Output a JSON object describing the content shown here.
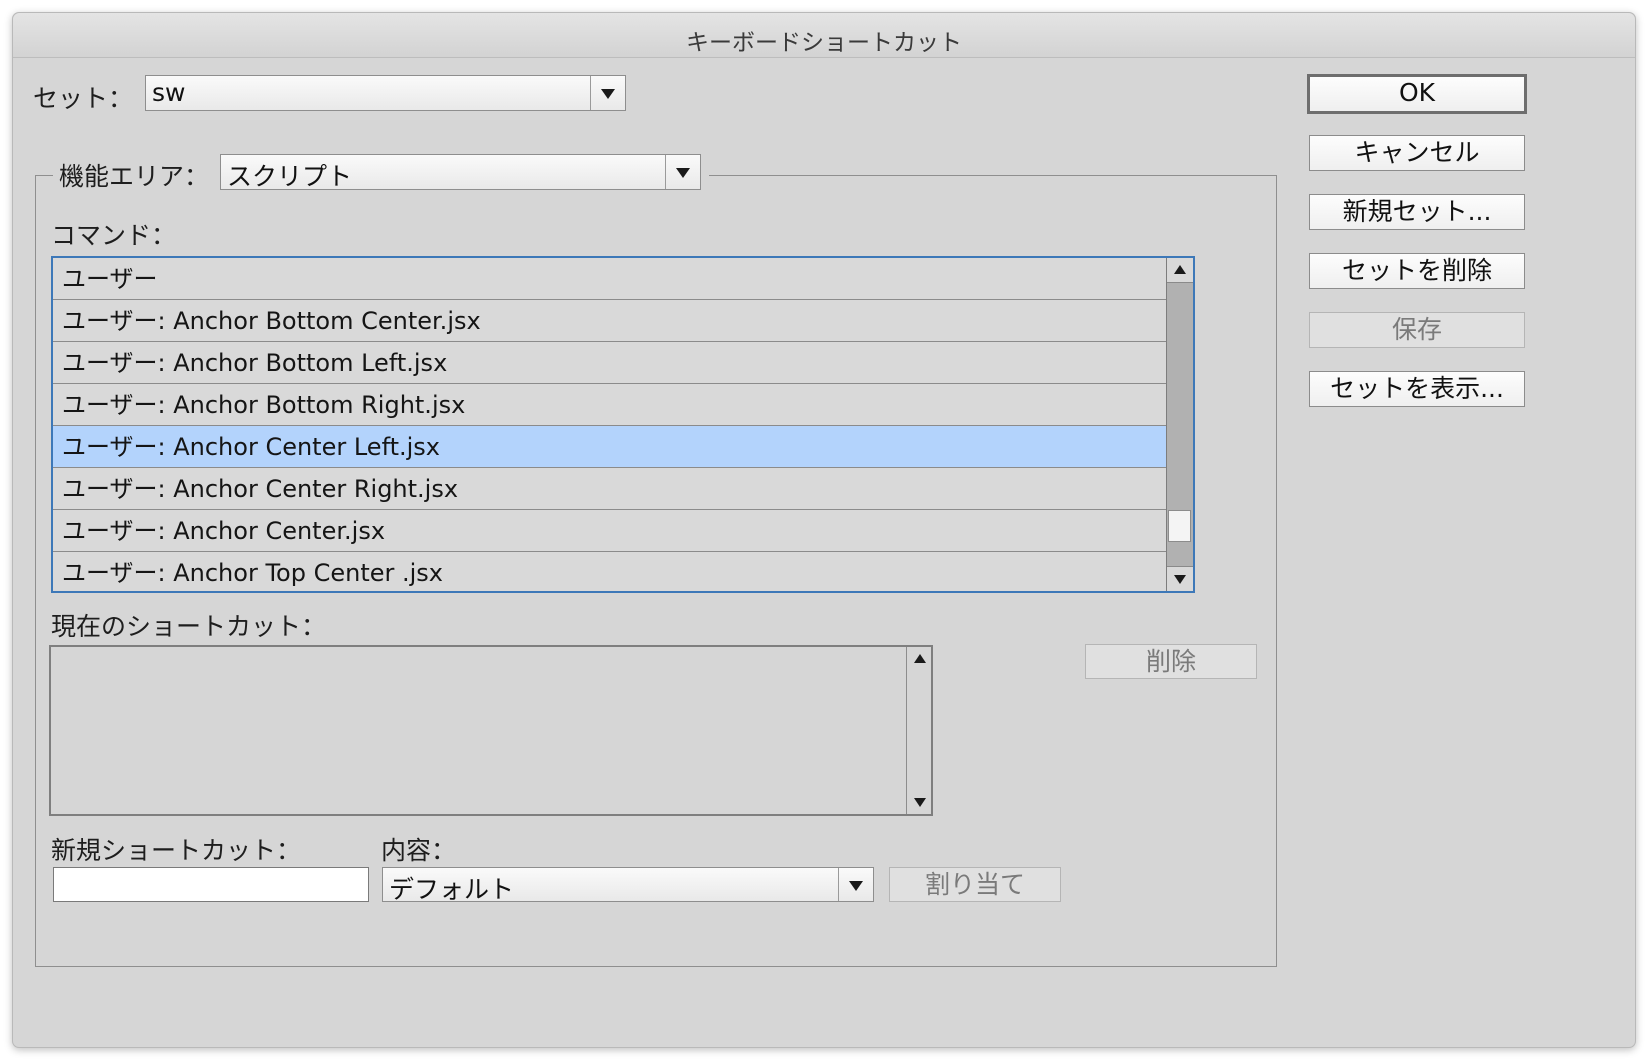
{
  "window": {
    "title": "キーボードショートカット"
  },
  "set": {
    "label": "セット：",
    "value": "sw"
  },
  "area": {
    "label": "機能エリア：",
    "value": "スクリプト"
  },
  "commands": {
    "label": "コマンド：",
    "items": [
      {
        "label": "ユーザー",
        "selected": false
      },
      {
        "label": "ユーザー: Anchor Bottom Center.jsx",
        "selected": false
      },
      {
        "label": "ユーザー: Anchor Bottom Left.jsx",
        "selected": false
      },
      {
        "label": "ユーザー: Anchor Bottom Right.jsx",
        "selected": false
      },
      {
        "label": "ユーザー: Anchor Center Left.jsx",
        "selected": true
      },
      {
        "label": "ユーザー: Anchor Center Right.jsx",
        "selected": false
      },
      {
        "label": "ユーザー: Anchor Center.jsx",
        "selected": false
      },
      {
        "label": "ユーザー: Anchor Top Center .jsx",
        "selected": false
      }
    ]
  },
  "current_shortcuts": {
    "label": "現在のショートカット：",
    "delete_label": "削除"
  },
  "new_shortcut": {
    "label": "新規ショートカット：",
    "value": ""
  },
  "context": {
    "label": "内容：",
    "value": "デフォルト"
  },
  "assign": {
    "label": "割り当て"
  },
  "buttons": {
    "ok": "OK",
    "cancel": "キャンセル",
    "new_set": "新規セット...",
    "delete_set": "セットを削除",
    "save": "保存",
    "show_set": "セットを表示..."
  },
  "colors": {
    "selection": "#b3d3fc",
    "focus_ring": "#3d78b8",
    "dialog_bg": "#d6d6d6"
  }
}
